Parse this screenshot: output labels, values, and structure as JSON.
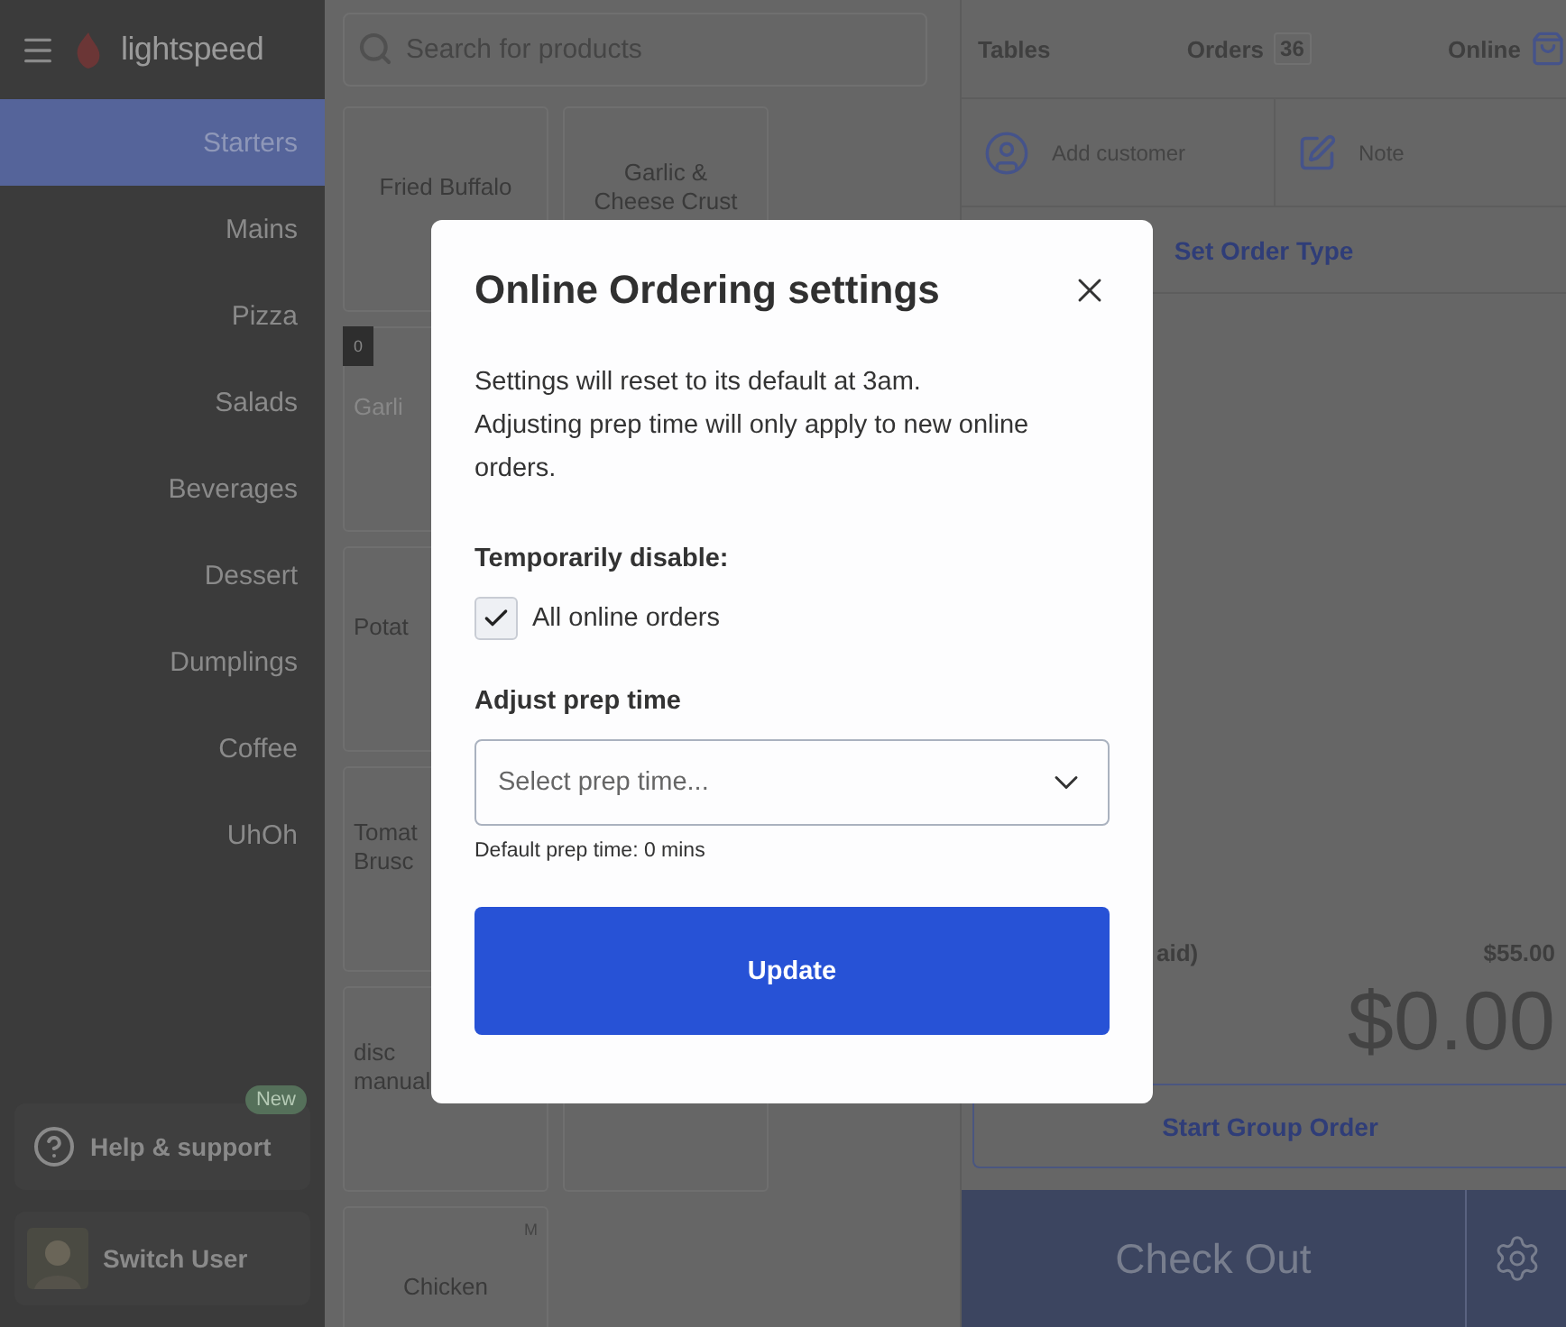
{
  "sidebar": {
    "brand": "lightspeed",
    "categories": [
      {
        "label": "Starters",
        "selected": true
      },
      {
        "label": "Mains",
        "selected": false
      },
      {
        "label": "Pizza",
        "selected": false
      },
      {
        "label": "Salads",
        "selected": false
      },
      {
        "label": "Beverages",
        "selected": false
      },
      {
        "label": "Dessert",
        "selected": false
      },
      {
        "label": "Dumplings",
        "selected": false
      },
      {
        "label": "Coffee",
        "selected": false
      },
      {
        "label": "UhOh",
        "selected": false
      }
    ],
    "help": {
      "label": "Help & support",
      "badge": "New"
    },
    "user": {
      "label": "Switch User"
    }
  },
  "search": {
    "placeholder": "Search for products"
  },
  "product_rows": [
    [
      {
        "kind": "item",
        "lines": [
          "Fried Buffalo"
        ],
        "disabled": false
      },
      {
        "kind": "item",
        "lines": [
          "Garlic &",
          "Cheese Crust"
        ],
        "disabled": false
      }
    ],
    [
      {
        "kind": "item",
        "lines": [
          "Garli"
        ],
        "disabled": true,
        "count": "0",
        "partial": true
      }
    ],
    [
      {
        "kind": "item",
        "lines": [
          "Potat"
        ],
        "disabled": false,
        "partial": true
      }
    ],
    [
      {
        "kind": "item",
        "lines": [
          "Tomat",
          "Brusc"
        ],
        "disabled": false,
        "partial": true
      }
    ],
    [
      {
        "kind": "item",
        "lines": [
          "disc",
          "manual"
        ],
        "disabled": false,
        "partial": true
      },
      {
        "kind": "blank"
      }
    ],
    [
      {
        "kind": "item",
        "lines": [
          "Chicken"
        ],
        "disabled": false,
        "tag": "M"
      }
    ]
  ],
  "order_tabs": [
    {
      "label": "Tables"
    },
    {
      "label": "Orders",
      "count": "36"
    },
    {
      "label": "Online"
    }
  ],
  "customer": {
    "label": "Add customer"
  },
  "note": {
    "label": "Note"
  },
  "order_type": "Set Order Type",
  "summary": {
    "label": "aid)",
    "amount": "$55.00"
  },
  "total": "$0.00",
  "group_order": "Start Group Order",
  "checkout": "Check Out",
  "modal": {
    "title": "Online Ordering settings",
    "paragraphs": [
      "Settings will reset to its default at 3am.",
      "Adjusting prep time will only apply to new online orders."
    ],
    "disable_heading": "Temporarily disable:",
    "option": {
      "label": "All online orders",
      "checked": true
    },
    "prep_heading": "Adjust prep time",
    "select": {
      "placeholder": "Select prep time..."
    },
    "hint": "Default prep time: 0 mins",
    "button": "Update"
  }
}
